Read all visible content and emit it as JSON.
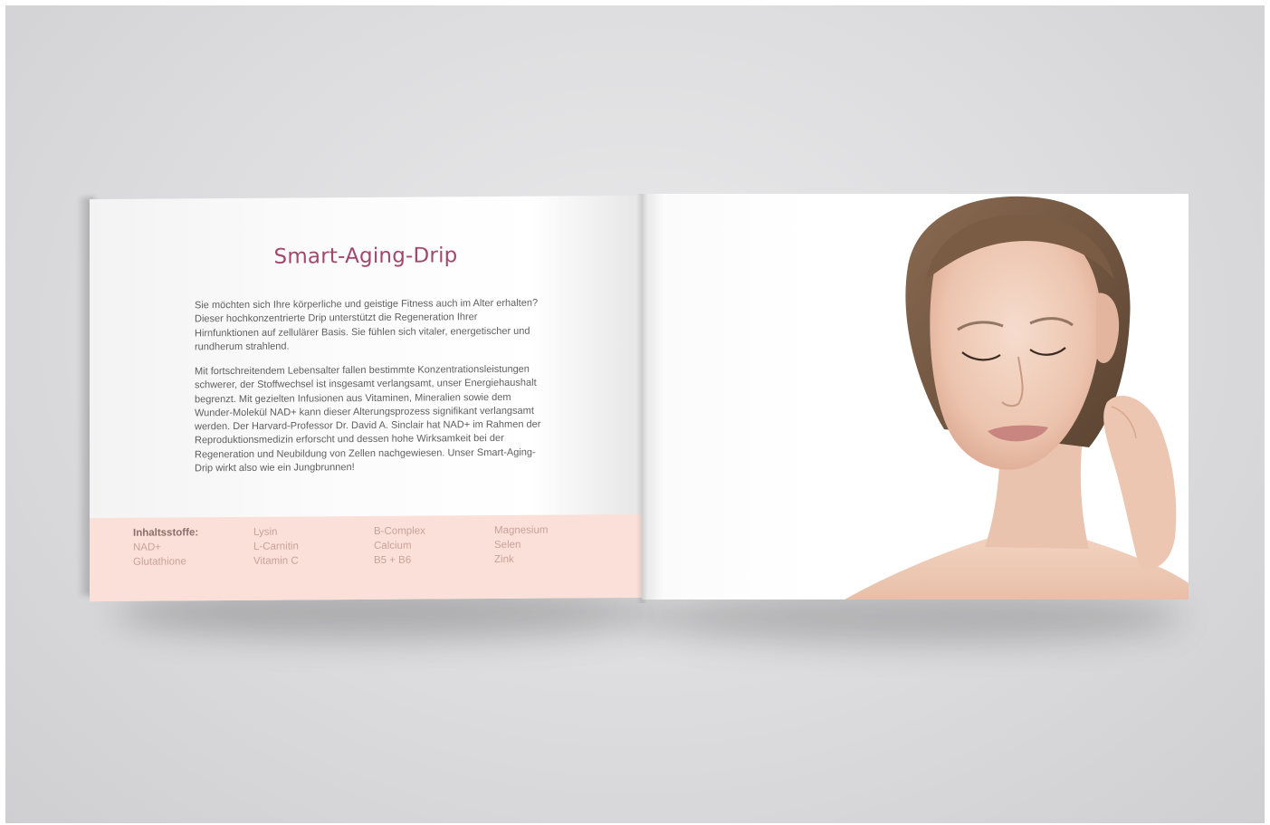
{
  "brochure": {
    "left_page": {
      "title": "Smart-Aging-Drip",
      "paragraph_1": "Sie möchten sich Ihre körperliche und geistige Fitness auch im Alter erhalten? Dieser hochkonzentrierte Drip unterstützt die Regeneration Ihrer Hirnfunktionen auf zellulärer Basis. Sie fühlen sich vitaler, energetischer und rundherum strahlend.",
      "paragraph_2": "Mit fortschreitendem Lebensalter fallen bestimmte Konzentrationsleistungen schwerer, der Stoffwechsel ist insgesamt verlangsamt, unser Energiehaushalt begrenzt. Mit gezielten Infusionen aus Vitaminen, Mineralien sowie dem Wunder-Molekül NAD+ kann dieser Alterungsprozess signifikant verlangsamt werden. Der Harvard-Professor Dr. David A. Sinclair hat NAD+ im Rahmen der Reproduktionsmedizin erforscht und dessen hohe Wirksamkeit bei der Regeneration und Neubildung von Zellen nachgewiesen. Unser Smart-Aging-Drip wirkt also wie ein Jungbrunnen!",
      "ingredients": {
        "heading": "Inhaltsstoffe:",
        "col1": [
          "NAD+",
          "Glutathione"
        ],
        "col2": [
          "Lysin",
          "L-Carnitin",
          "Vitamin C"
        ],
        "col3": [
          "B-Complex",
          "Calcium",
          "B5 + B6"
        ],
        "col4": [
          "Magnesium",
          "Selen",
          "Zink"
        ]
      }
    },
    "right_page": {
      "image": "portrait-photo"
    },
    "colors": {
      "title": "#a3476b",
      "ingredients_band": "#fbe0d9",
      "background": "#dcdcde"
    }
  }
}
